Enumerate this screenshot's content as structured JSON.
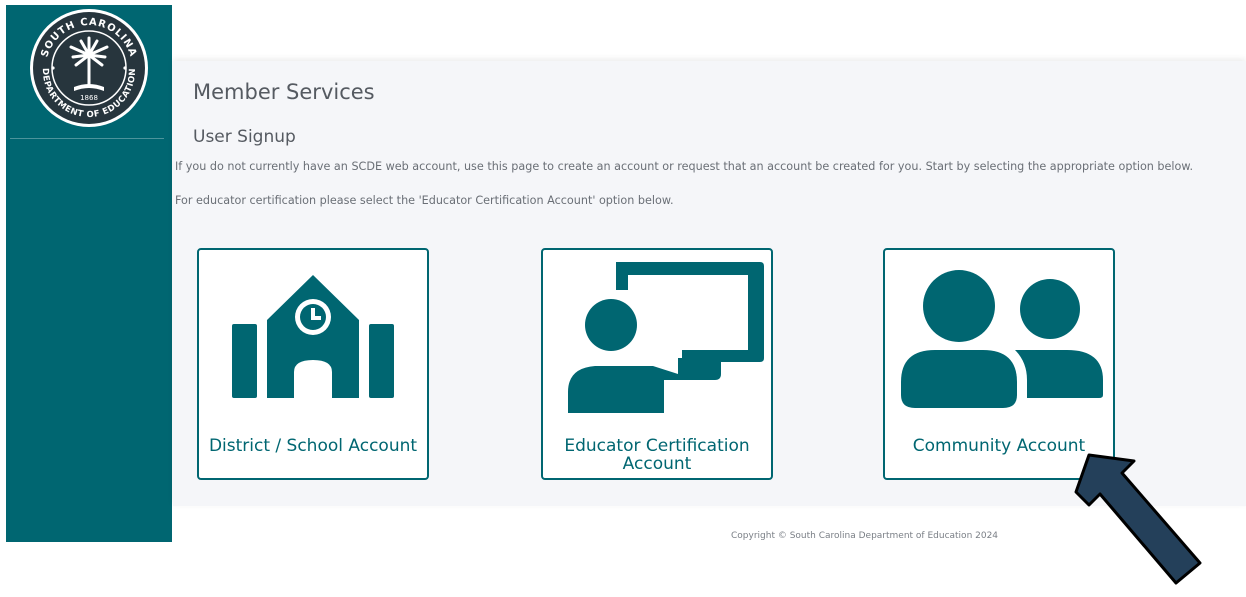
{
  "sidebar": {
    "seal": {
      "top_text": "SOUTH CAROLINA",
      "bottom_text": "DEPARTMENT OF EDUCATION",
      "year": "1868",
      "icon": "palmetto-tree-icon"
    }
  },
  "main": {
    "title": "Member Services",
    "section_title": "User Signup",
    "intro": "If you do not currently have an SCDE web account, use this page to create an account or request that an account be created for you. Start by selecting the appropriate option below.",
    "certification_note": "For educator certification please select the 'Educator Certification Account' option below.",
    "options": [
      {
        "label": "District / School Account",
        "icon": "school-building-icon"
      },
      {
        "label_line1": "Educator Certification",
        "label_line2": "Account",
        "icon": "teacher-board-icon"
      },
      {
        "label": "Community Account",
        "icon": "people-icon"
      }
    ]
  },
  "footer": {
    "copyright": "Copyright © South Carolina Department of Education 2024"
  },
  "annotation": {
    "icon": "pointer-arrow-icon",
    "color": "#24405a"
  },
  "colors": {
    "brand": "#006671",
    "background": "#f5f6f9"
  }
}
